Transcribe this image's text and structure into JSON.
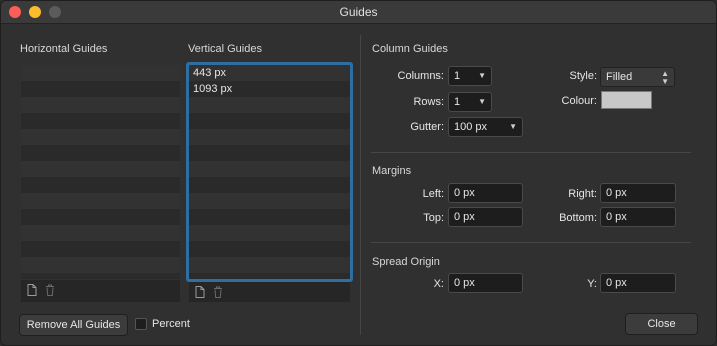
{
  "window": {
    "title": "Guides"
  },
  "horizontal": {
    "header": "Horizontal Guides",
    "items": []
  },
  "vertical": {
    "header": "Vertical Guides",
    "items": [
      "443 px",
      "1093 px"
    ]
  },
  "buttons": {
    "remove_all": "Remove All Guides",
    "close": "Close"
  },
  "percent_label": "Percent",
  "column_guides": {
    "header": "Column Guides",
    "columns_label": "Columns:",
    "columns_value": "1",
    "rows_label": "Rows:",
    "rows_value": "1",
    "gutter_label": "Gutter:",
    "gutter_value": "100 px",
    "style_label": "Style:",
    "style_value": "Filled",
    "colour_label": "Colour:",
    "colour_value": "#c8c8c8"
  },
  "margins": {
    "header": "Margins",
    "left_label": "Left:",
    "left_value": "0 px",
    "right_label": "Right:",
    "right_value": "0 px",
    "top_label": "Top:",
    "top_value": "0 px",
    "bottom_label": "Bottom:",
    "bottom_value": "0 px"
  },
  "spread_origin": {
    "header": "Spread Origin",
    "x_label": "X:",
    "x_value": "0 px",
    "y_label": "Y:",
    "y_value": "0 px"
  }
}
